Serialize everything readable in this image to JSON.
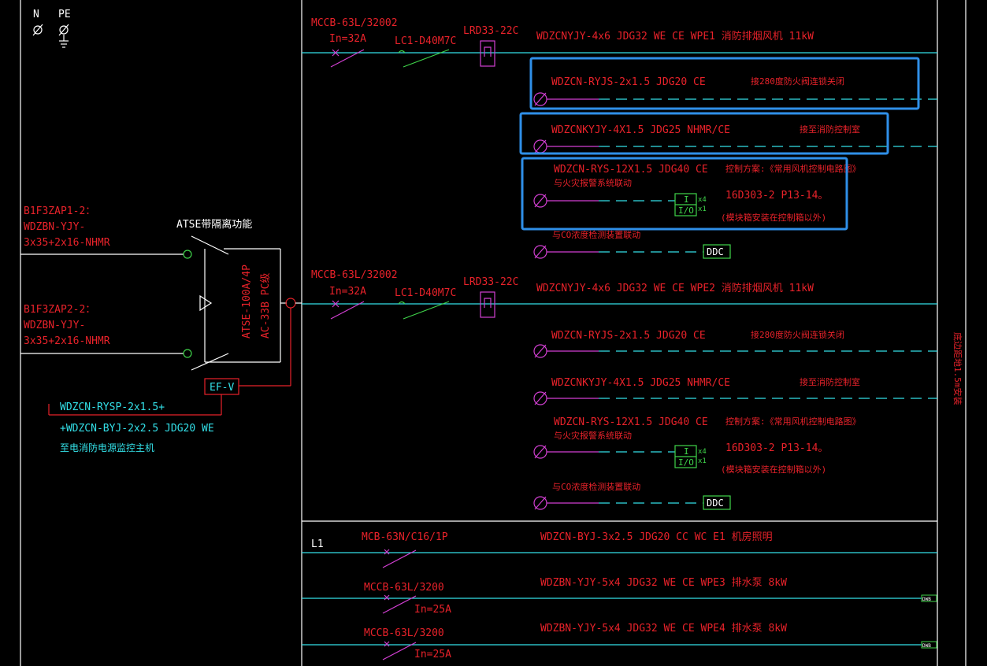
{
  "colors": {
    "background": "#000000",
    "red": "#e8222a",
    "cyan": "#33e0e8",
    "magenta": "#d23fd2",
    "green": "#3fd44a",
    "highlight": "#2f8fe8"
  },
  "legend": {
    "n_label": "N",
    "pe_label": "PE"
  },
  "incoming": {
    "feeder1": {
      "line1": "B1F3ZAP1-2：",
      "line2": "WDZBN-YJY-",
      "line3": "3x35+2x16-NHMR"
    },
    "feeder2": {
      "line1": "B1F3ZAP2-2：",
      "line2": "WDZBN-YJY-",
      "line3": "3x35+2x16-NHMR"
    },
    "atse_title": "ATSE带隔离功能",
    "atse_model1": "ATSE-100A/4P",
    "atse_model2": "AC-33B PC级",
    "efv_label": "EF-V",
    "monitor_line1": "WDZCN-RYSP-2x1.5+",
    "monitor_line2": "+WDZCN-BYJ-2x2.5  JDG20  WE",
    "monitor_line3": "至电消防电源监控主机"
  },
  "block1": {
    "mccb": "MCCB-63L/32002",
    "in": "In=32A",
    "contactor": "LC1-D40M7C",
    "relay": "LRD33-22C",
    "main_cable": "WDZCNYJY-4x6  JDG32  WE  CE    WPE1  消防排烟风机  11kW",
    "ctrl1_cable": "WDZCN-RYJS-2x1.5  JDG20  CE",
    "ctrl1_desc": "接280度防火阀连锁关闭",
    "ctrl2_cable": "WDZCNKYJY-4X1.5  JDG25  NHMR/CE",
    "ctrl2_desc": "接至消防控制室",
    "ctrl3_cable": "WDZCN-RYS-12X1.5  JDG40  CE",
    "ctrl3_scheme": "控制方案:《常用风机控制电路图》",
    "ctrl3_link": "与火灾报警系统联动",
    "ctrl3_std": "16D303-2  P13-14。",
    "ctrl3_note": "(模块箱安装在控制箱以外)",
    "io_top": "I",
    "io_bottom": "I/O",
    "io_x4": "x4",
    "io_x1": "x1",
    "co_desc": "与CO浓度检测装置联动",
    "ddc": "DDC"
  },
  "block2": {
    "mccb": "MCCB-63L/32002",
    "in": "In=32A",
    "contactor": "LC1-D40M7C",
    "relay": "LRD33-22C",
    "main_cable": "WDZCNYJY-4x6  JDG32  WE  CE    WPE2  消防排烟风机  11kW",
    "ctrl1_cable": "WDZCN-RYJS-2x1.5  JDG20  CE",
    "ctrl1_desc": "接280度防火阀连锁关闭",
    "ctrl2_cable": "WDZCNKYJY-4X1.5  JDG25  NHMR/CE",
    "ctrl2_desc": "接至消防控制室",
    "ctrl3_cable": "WDZCN-RYS-12X1.5  JDG40  CE",
    "ctrl3_scheme": "控制方案:《常用风机控制电路图》",
    "ctrl3_link": "与火灾报警系统联动",
    "ctrl3_std": "16D303-2  P13-14。",
    "ctrl3_note": "(模块箱安装在控制箱以外)",
    "io_top": "I",
    "io_bottom": "I/O",
    "io_x4": "x4",
    "io_x1": "x1",
    "co_desc": "与CO浓度检测装置联动",
    "ddc": "DDC"
  },
  "lighting": {
    "phase": "L1",
    "breaker": "MCB-63N/C16/1P",
    "cable": "WDZCN-BYJ-3x2.5  JDG20  CC  WC     E1        机房照明"
  },
  "pump1": {
    "breaker": "MCCB-63L/3200",
    "in": "In=25A",
    "cable": "WDZBN-YJY-5x4  JDG32  WE  CE        WPE3          排水泵  8kW",
    "tag": "DWB"
  },
  "pump2": {
    "breaker": "MCCB-63L/3200",
    "in": "In=25A",
    "cable": "WDZBN-YJY-5x4  JDG32  WE  CE        WPE4          排水泵  8kW",
    "tag": "DWB"
  },
  "side_note": "底边距地1.5m安装"
}
